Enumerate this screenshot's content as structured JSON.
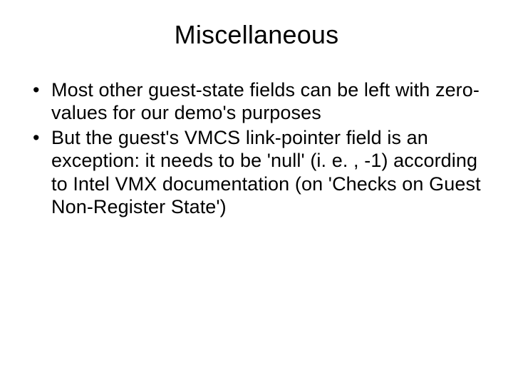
{
  "slide": {
    "title": "Miscellaneous",
    "bullets": [
      "Most other guest-state fields can be left with zero-values for our demo's purposes",
      "But the guest's VMCS link-pointer field is an exception: it needs to be 'null' (i. e. , -1) according to Intel VMX documentation (on 'Checks on Guest Non-Register State')"
    ]
  }
}
